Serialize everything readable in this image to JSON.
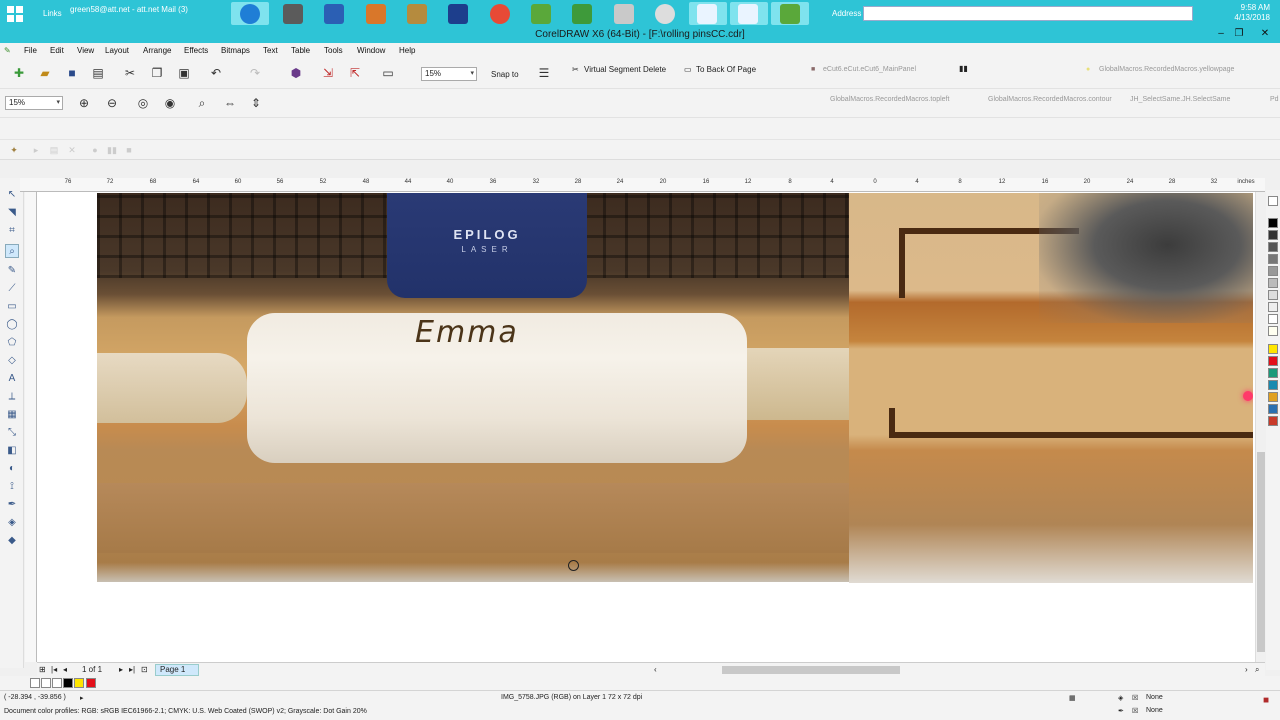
{
  "taskbar": {
    "links_label": "Links",
    "mail_label": "green58@att.net - att.net Mail (3)",
    "address_label": "Address",
    "time": "9:58 AM",
    "date": "4/13/2018"
  },
  "window": {
    "title": "CorelDRAW X6 (64-Bit) - [F:\\rolling pinsCC.cdr]"
  },
  "menu": [
    "File",
    "Edit",
    "View",
    "Layout",
    "Arrange",
    "Effects",
    "Bitmaps",
    "Text",
    "Table",
    "Tools",
    "Window",
    "Help"
  ],
  "toolbar": {
    "zoom_value": "15%",
    "snap_to": "Snap to",
    "virtual_segment_delete": "Virtual Segment Delete",
    "to_back_of_page": "To Back Of Page",
    "macro_main_panel": "eCut6.eCut.eCut6_MainPanel",
    "macro_yellowpage": "GlobalMacros.RecordedMacros.yellowpage",
    "macro_topleft": "GlobalMacros.RecordedMacros.topleft",
    "macro_contour": "GlobalMacros.RecordedMacros.contour",
    "macro_selectsame": "JH_SelectSame.JH.SelectSame",
    "macro_pd": "Pd",
    "zoom_combo": "15%"
  },
  "ruler": {
    "unit": "inches",
    "labels": [
      "76",
      "72",
      "68",
      "64",
      "60",
      "56",
      "52",
      "48",
      "44",
      "40",
      "36",
      "32",
      "28",
      "24",
      "20",
      "16",
      "12",
      "8",
      "4",
      "0",
      "4",
      "8",
      "12",
      "16",
      "20",
      "24",
      "28",
      "32"
    ]
  },
  "photo": {
    "brand": "EPILOG",
    "brand_sub": "LASER",
    "engraving": "Emma"
  },
  "pagebar": {
    "page_count": "1 of 1",
    "page_tab": "Page 1"
  },
  "status": {
    "coords": "( -28.394 , -39.856 )",
    "object_info": "IMG_5758.JPG (RGB) on Layer 1 72 x 72 dpi",
    "color_profiles": "Document color profiles: RGB: sRGB IEC61966-2.1; CMYK: U.S. Web Coated (SWOP) v2; Grayscale: Dot Gain 20%",
    "fill": "None",
    "outline": "None"
  },
  "colors": {
    "taskbar": "#2ec4d6",
    "page_tab": "#cfe8fb"
  }
}
